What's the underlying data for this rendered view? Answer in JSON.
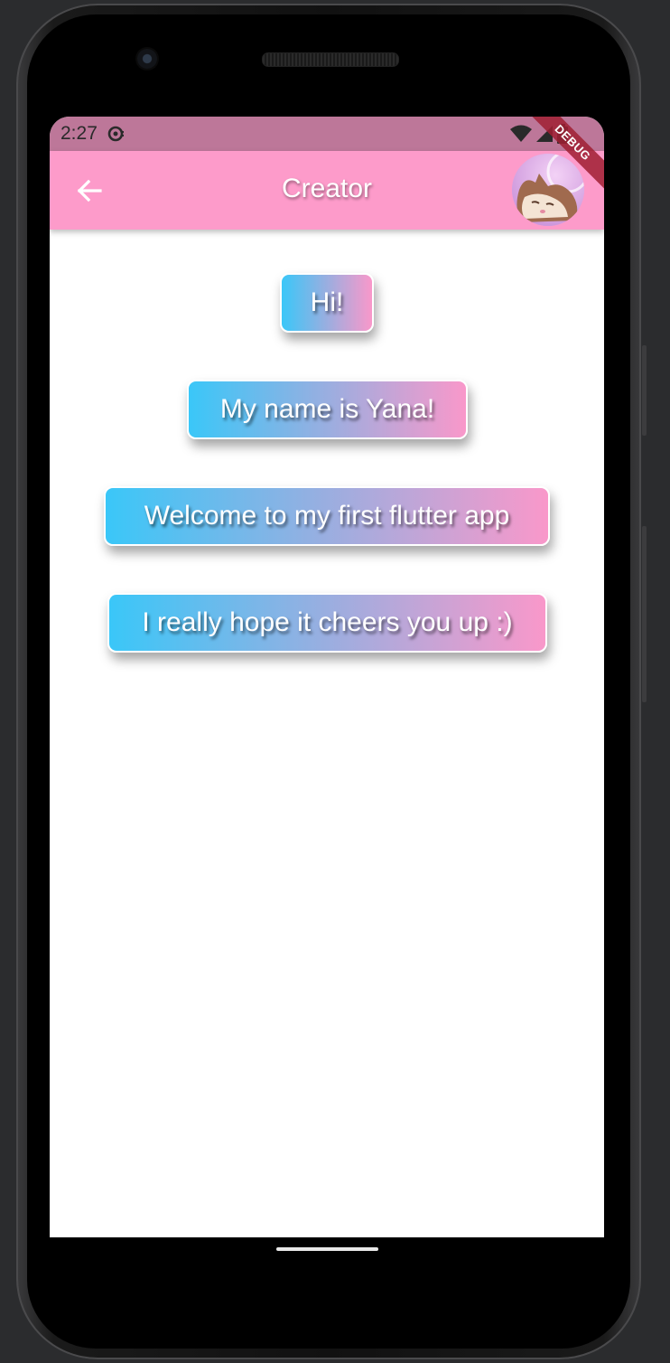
{
  "status_bar": {
    "time": "2:27"
  },
  "app_bar": {
    "title": "Creator",
    "back_icon": "arrow-left-icon",
    "avatar_icon": "cat-avatar"
  },
  "debug_banner": "DEBUG",
  "messages": [
    "Hi!",
    "My name is Yana!",
    "Welcome to my first flutter app",
    "I really hope it cheers you up :)"
  ],
  "colors": {
    "app_bar": "#fd9bca",
    "status_bar": "#bd7799",
    "bubble_gradient_start": "#3ac7f8",
    "bubble_gradient_end": "#f998ca"
  }
}
